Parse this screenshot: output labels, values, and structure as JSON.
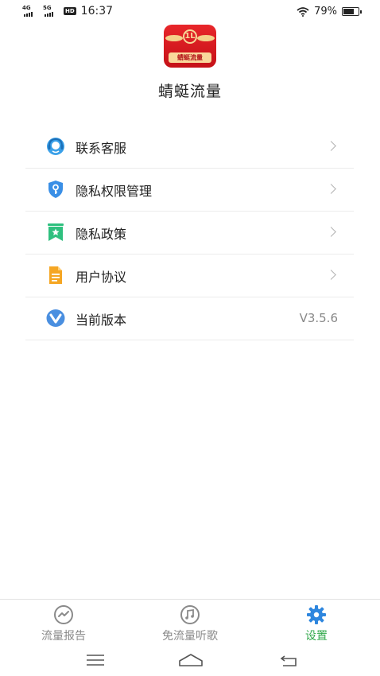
{
  "status_bar": {
    "network_1": "4G",
    "network_2": "5G",
    "hd_badge": "HD",
    "time": "16:37",
    "battery_percent": "79%",
    "battery_level": 0.79
  },
  "app": {
    "logo_text": "蜻蜓流量",
    "emblem_char": "1L",
    "name": "蜻蜓流量"
  },
  "menu": {
    "items": [
      {
        "label": "联系客服",
        "icon": "headset-icon",
        "color": "#3aa0e8"
      },
      {
        "label": "隐私权限管理",
        "icon": "shield-key-icon",
        "color": "#3a8fe6"
      },
      {
        "label": "隐私政策",
        "icon": "bookmark-star-icon",
        "color": "#2fc07f"
      },
      {
        "label": "用户协议",
        "icon": "document-icon",
        "color": "#f5a623"
      },
      {
        "label": "当前版本",
        "icon": "version-v-icon",
        "color": "#4a8fe0",
        "value": "V3.5.6"
      }
    ]
  },
  "bottom_nav": {
    "tabs": [
      {
        "label": "流量报告",
        "icon": "chart-circle-icon",
        "active": false
      },
      {
        "label": "免流量听歌",
        "icon": "music-note-icon",
        "active": false
      },
      {
        "label": "设置",
        "icon": "gear-icon",
        "active": true
      }
    ],
    "active_color": "#32a94c"
  }
}
